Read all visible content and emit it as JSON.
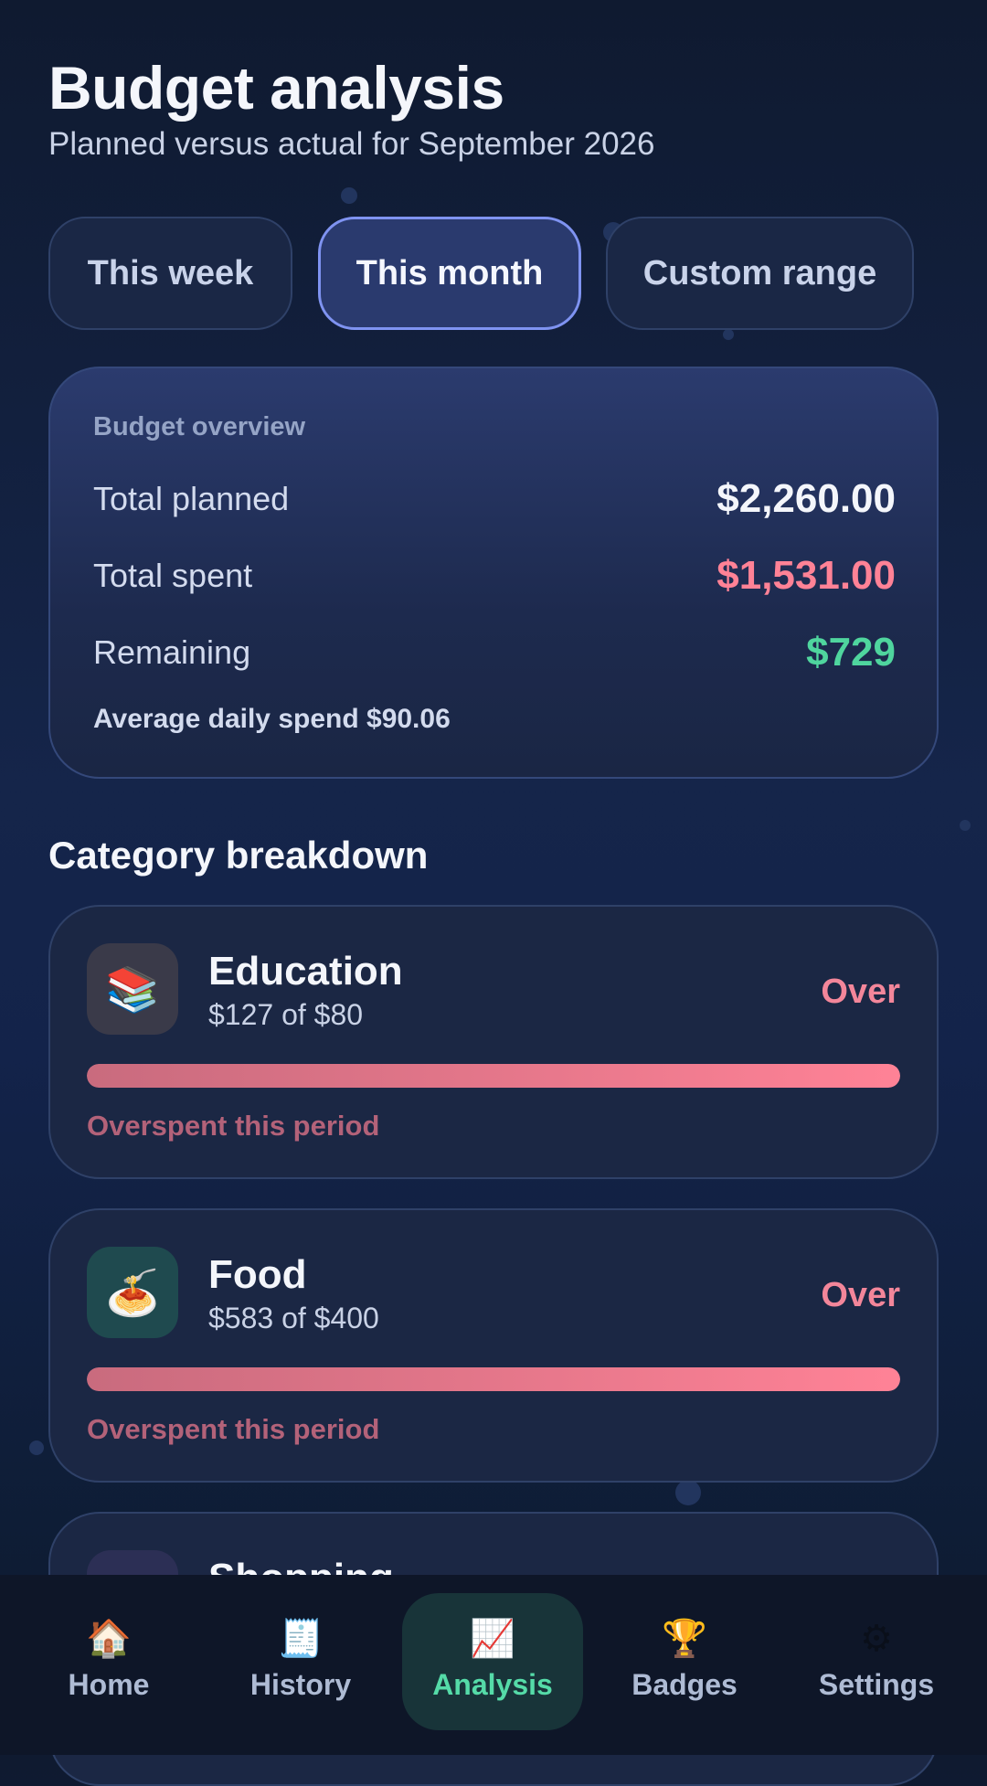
{
  "header": {
    "title": "Budget analysis",
    "subtitle": "Planned versus actual for September 2026"
  },
  "tabs": [
    {
      "label": "This week",
      "active": false
    },
    {
      "label": "This month",
      "active": true
    },
    {
      "label": "Custom range",
      "active": false
    }
  ],
  "overview": {
    "label": "Budget overview",
    "planned_label": "Total planned",
    "planned_value": "$2,260.00",
    "spent_label": "Total spent",
    "spent_value": "$1,531.00",
    "remaining_label": "Remaining",
    "remaining_value": "$729",
    "average": "Average daily spend $90.06"
  },
  "section_title": "Category breakdown",
  "categories": [
    {
      "name": "Education",
      "amount": "$127 of $80",
      "status": "Over",
      "note": "Overspent this period",
      "progress": 1.0,
      "icon": "📚",
      "icon_name": "books-icon",
      "icon_bg": "#3a3a49"
    },
    {
      "name": "Food",
      "amount": "$583 of $400",
      "status": "Over",
      "note": "Overspent this period",
      "progress": 1.0,
      "icon": "🍝",
      "icon_name": "spaghetti-icon",
      "icon_bg": "#1f4a4f"
    },
    {
      "name": "Shopping"
    }
  ],
  "nav": [
    {
      "label": "Home",
      "icon": "🏠",
      "icon_name": "home-icon",
      "active": false
    },
    {
      "label": "History",
      "icon": "🧾",
      "icon_name": "receipt-icon",
      "active": false
    },
    {
      "label": "Analysis",
      "icon": "📈",
      "icon_name": "chart-icon",
      "active": true
    },
    {
      "label": "Badges",
      "icon": "🏆",
      "icon_name": "trophy-icon",
      "active": false
    },
    {
      "label": "Settings",
      "icon": "⚙",
      "icon_name": "gear-icon",
      "active": false
    }
  ],
  "colors": {
    "accent": "#7f93f1",
    "spent": "#ff8296",
    "remaining": "#4fd59e",
    "over": "#f3869a",
    "active_nav": "#55dba8"
  }
}
